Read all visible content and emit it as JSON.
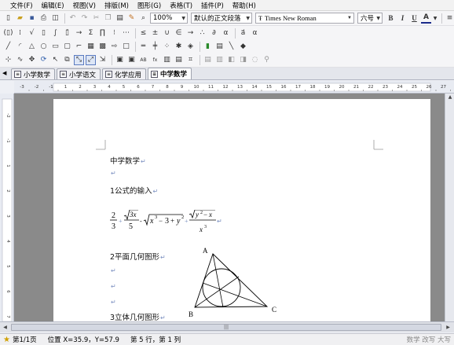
{
  "menu": [
    "文件(F)",
    "编辑(E)",
    "视图(V)",
    "排版(M)",
    "图形(G)",
    "表格(T)",
    "插件(P)",
    "帮助(H)"
  ],
  "toolbar1": {
    "zoom": "100%",
    "style": "默认的正文段落",
    "font": "Times New Roman",
    "size": "六号",
    "bold": "B",
    "italic": "I",
    "underline": "U",
    "color_letter": "A"
  },
  "tabs": [
    "小学数学",
    "小学语文",
    "化学应用",
    "中学数学"
  ],
  "active_tab": "中学数学",
  "ruler": [
    "-3",
    "-2",
    "-1",
    "1",
    "2",
    "3",
    "4",
    "5",
    "6",
    "7",
    "8",
    "9",
    "10",
    "11",
    "12",
    "13",
    "14",
    "15",
    "16",
    "17",
    "18",
    "19",
    "20",
    "21",
    "22",
    "23",
    "24",
    "25",
    "26",
    "27"
  ],
  "vruler": [
    "-2",
    "-1",
    "1",
    "2",
    "3",
    "4",
    "5",
    "6",
    "7"
  ],
  "document": {
    "title": "中学数学",
    "section1": "1公式的输入",
    "section2": "2平面几何图形",
    "section3": "3立体几何图形",
    "formula": {
      "f1_num": "2",
      "f1_den": "3",
      "f2_rad": "3x",
      "f2_den": "5",
      "f3_a": "x",
      "f3_a_exp": "3",
      "f3_b": "3",
      "f3_c": "y",
      "f3_c_exp": "2",
      "f4_rad_a": "y",
      "f4_rad_exp": "2",
      "f4_rad_b": "x",
      "f4_den": "x",
      "f4_den_exp": "3"
    },
    "geometry": {
      "label_a": "A",
      "label_b": "B",
      "label_c": "C"
    }
  },
  "status": {
    "page": "第1/1页",
    "position": "位置 X=35.9，Y=57.9",
    "rowcol": "第 5 行，第 1 列",
    "modes": "数学 改写 大写"
  },
  "colors": {
    "accent": "#2a5aa8",
    "para_mark": "#7a8fc0"
  }
}
